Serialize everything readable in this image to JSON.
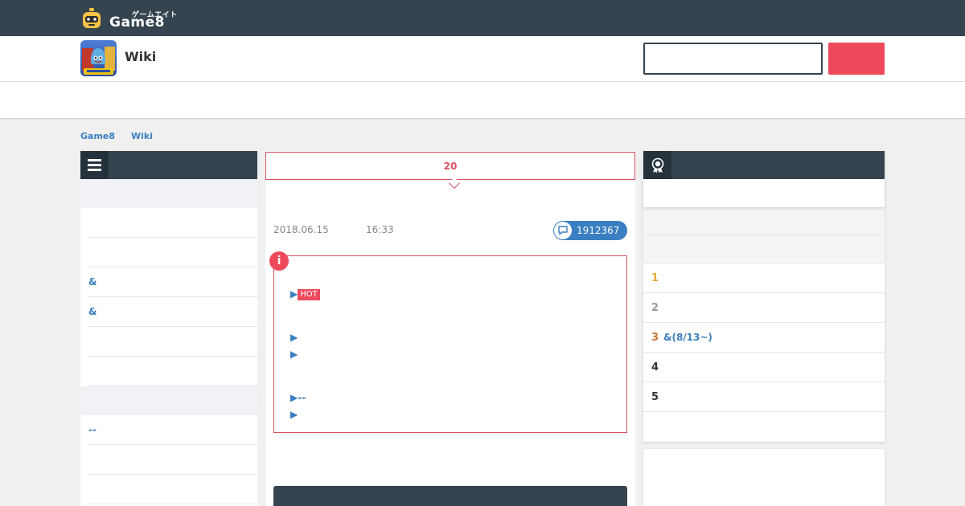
{
  "header": {
    "logo_kana": "ゲームエイト",
    "logo_brand": "Game8"
  },
  "subheader": {
    "title": "Wiki",
    "search": {
      "value": "",
      "placeholder": ""
    },
    "search_button_label": ""
  },
  "breadcrumb": [
    "Game8",
    "Wiki"
  ],
  "left_menu": {
    "rows": [
      "",
      "",
      "&",
      "&",
      "",
      ""
    ],
    "rows2": [
      "--",
      "",
      ""
    ]
  },
  "article": {
    "announcement": "20",
    "date": "2018.06.15",
    "time": "16:33",
    "comment_count": "1912367",
    "info_icon": "i",
    "links": [
      {
        "prefix": "▶",
        "text": "",
        "hot": "HOT",
        "suffix": ""
      },
      {
        "prefix": "▶",
        "text": "",
        "hot": "",
        "suffix": ""
      },
      {
        "prefix": "▶",
        "text": "",
        "hot": "",
        "suffix": ""
      },
      {
        "prefix": "▶",
        "text": "--",
        "hot": "",
        "suffix": ""
      },
      {
        "prefix": "▶",
        "text": "",
        "hot": "",
        "suffix": ""
      }
    ]
  },
  "ranking": {
    "items": [
      {
        "rank": "1",
        "label": "",
        "color": "#e8a93a"
      },
      {
        "rank": "2",
        "label": "",
        "color": "#999999"
      },
      {
        "rank": "3",
        "label": "&(8/13~)",
        "color": "#c97a3a"
      },
      {
        "rank": "4",
        "label": "",
        "color": "#333333"
      },
      {
        "rank": "5",
        "label": "",
        "color": "#333333"
      }
    ]
  },
  "colors": {
    "header_bg": "#35444f",
    "accent_red": "#ec4a5b",
    "link_blue": "#3a7fc1"
  },
  "icons": {
    "menu": "hamburger-icon",
    "ranking": "medal-icon",
    "comment": "comment-icon",
    "info": "info-icon"
  }
}
